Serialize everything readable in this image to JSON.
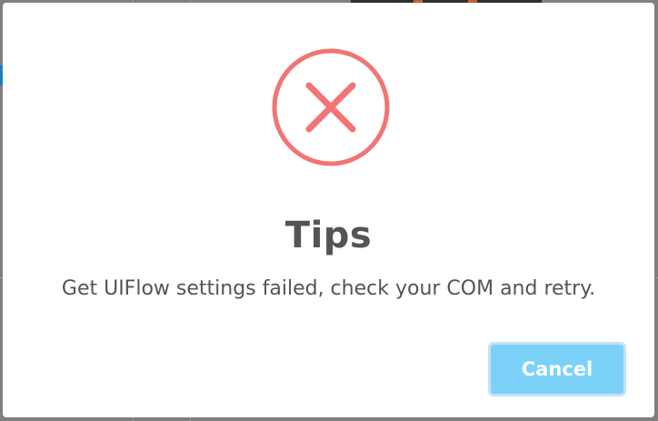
{
  "dialog": {
    "title": "Tips",
    "message": "Get UIFlow settings failed, check your COM and retry.",
    "cancel_label": "Cancel",
    "icon": "error-x-icon"
  },
  "colors": {
    "error": "#f27474",
    "button": "#7cd1f9",
    "button_border": "#c6e2f2",
    "text": "#545454"
  }
}
